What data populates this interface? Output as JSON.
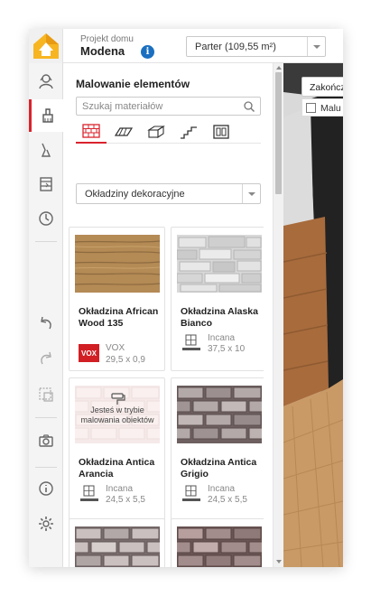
{
  "header": {
    "project_label": "Projekt domu",
    "project_name": "Modena",
    "info_icon": "info-icon",
    "floor_select": "Parter (109,55 m²)"
  },
  "toolbar": {
    "icons": [
      "avatar-icon",
      "paint-brush-icon",
      "roller-brush-icon",
      "bookshelf-icon",
      "clock-icon",
      "undo-icon",
      "redo-icon",
      "camera-icon",
      "info-icon",
      "gear-icon",
      "chevron-right-icon"
    ],
    "active_color": "#d9232d"
  },
  "panel": {
    "title": "Malowanie elementów",
    "search_placeholder": "Szukaj materiałów",
    "tabs": [
      "brick-tab-icon",
      "floor-tab-icon",
      "box-tab-icon",
      "stairs-tab-icon",
      "window-tab-icon"
    ],
    "category": "Okładziny dekoracyjne",
    "paint_mode_overlay": "Jesteś w trybie malowania obiektów",
    "items": [
      {
        "name": "Okładzina African Wood 135",
        "brand": "VOX",
        "dims": "29,5 x 0,9"
      },
      {
        "name": "Okładzina Alaska Bianco",
        "brand": "Incana",
        "dims": "37,5 x 10"
      },
      {
        "name": "Okładzina Antica Arancia",
        "brand": "Incana",
        "dims": "24,5 x 5,5"
      },
      {
        "name": "Okładzina Antica Grigio",
        "brand": "Incana",
        "dims": "24,5 x 5,5"
      }
    ]
  },
  "view3d": {
    "finish_button": "Zakończ",
    "paint_checkbox": "Malu"
  }
}
